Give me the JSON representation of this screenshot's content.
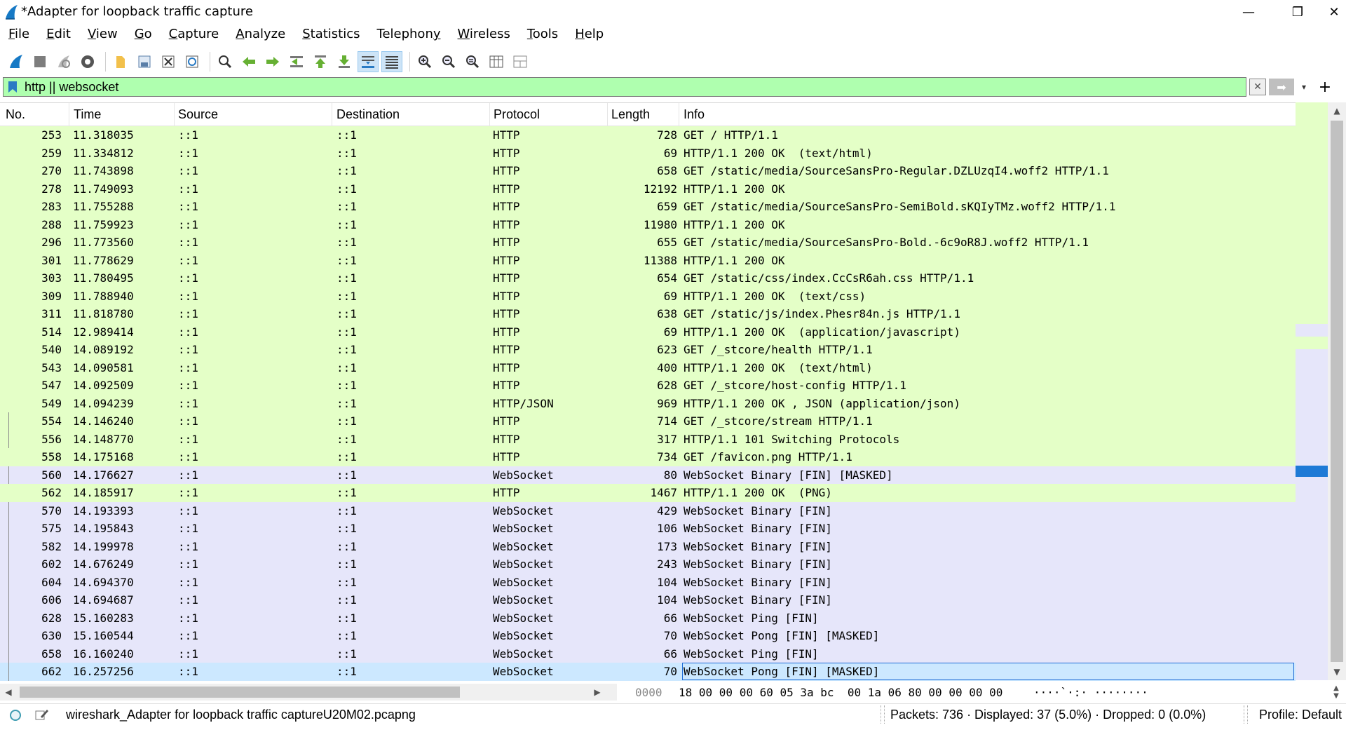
{
  "window": {
    "title": "*Adapter for loopback traffic capture",
    "minimize": "—",
    "restore": "❐",
    "close": "✕"
  },
  "menu": [
    {
      "label": "File",
      "key": "F",
      "rest": "ile"
    },
    {
      "label": "Edit",
      "key": "E",
      "rest": "dit"
    },
    {
      "label": "View",
      "key": "V",
      "rest": "iew"
    },
    {
      "label": "Go",
      "key": "G",
      "rest": "o"
    },
    {
      "label": "Capture",
      "key": "C",
      "rest": "apture"
    },
    {
      "label": "Analyze",
      "key": "A",
      "rest": "nalyze"
    },
    {
      "label": "Statistics",
      "key": "S",
      "rest": "tatistics"
    },
    {
      "label": "Telephony",
      "key": "y",
      "pre": "Telephon",
      "rest": ""
    },
    {
      "label": "Wireless",
      "key": "W",
      "rest": "ireless"
    },
    {
      "label": "Tools",
      "key": "T",
      "rest": "ools"
    },
    {
      "label": "Help",
      "key": "H",
      "rest": "elp"
    }
  ],
  "toolbar_icons": [
    "start-capture-icon",
    "stop-capture-icon",
    "restart-capture-icon",
    "capture-options-icon",
    "open-file-icon",
    "save-file-icon",
    "close-file-icon",
    "reload-file-icon",
    "find-packet-icon",
    "go-back-icon",
    "go-forward-icon",
    "go-to-packet-icon",
    "first-packet-icon",
    "last-packet-icon",
    "autoscroll-icon",
    "colorize-icon",
    "zoom-in-icon",
    "zoom-out-icon",
    "zoom-normal-icon",
    "resize-columns-icon",
    "layout-icon"
  ],
  "filter": {
    "text": "http || websocket",
    "clear": "✕",
    "apply": "➡",
    "dropdown": "▾",
    "add": "+"
  },
  "columns": {
    "no": "No.",
    "time": "Time",
    "source": "Source",
    "destination": "Destination",
    "protocol": "Protocol",
    "length": "Length",
    "info": "Info"
  },
  "packets": [
    {
      "no": "253",
      "time": "11.318035",
      "src": "::1",
      "dst": "::1",
      "proto": "HTTP",
      "len": "728",
      "info": "GET / HTTP/1.1",
      "kind": "http",
      "tree": false
    },
    {
      "no": "259",
      "time": "11.334812",
      "src": "::1",
      "dst": "::1",
      "proto": "HTTP",
      "len": "69",
      "info": "HTTP/1.1 200 OK  (text/html)",
      "kind": "http",
      "tree": false
    },
    {
      "no": "270",
      "time": "11.743898",
      "src": "::1",
      "dst": "::1",
      "proto": "HTTP",
      "len": "658",
      "info": "GET /static/media/SourceSansPro-Regular.DZLUzqI4.woff2 HTTP/1.1",
      "kind": "http",
      "tree": false
    },
    {
      "no": "278",
      "time": "11.749093",
      "src": "::1",
      "dst": "::1",
      "proto": "HTTP",
      "len": "12192",
      "info": "HTTP/1.1 200 OK",
      "kind": "http",
      "tree": false
    },
    {
      "no": "283",
      "time": "11.755288",
      "src": "::1",
      "dst": "::1",
      "proto": "HTTP",
      "len": "659",
      "info": "GET /static/media/SourceSansPro-SemiBold.sKQIyTMz.woff2 HTTP/1.1",
      "kind": "http",
      "tree": false
    },
    {
      "no": "288",
      "time": "11.759923",
      "src": "::1",
      "dst": "::1",
      "proto": "HTTP",
      "len": "11980",
      "info": "HTTP/1.1 200 OK",
      "kind": "http",
      "tree": false
    },
    {
      "no": "296",
      "time": "11.773560",
      "src": "::1",
      "dst": "::1",
      "proto": "HTTP",
      "len": "655",
      "info": "GET /static/media/SourceSansPro-Bold.-6c9oR8J.woff2 HTTP/1.1",
      "kind": "http",
      "tree": false
    },
    {
      "no": "301",
      "time": "11.778629",
      "src": "::1",
      "dst": "::1",
      "proto": "HTTP",
      "len": "11388",
      "info": "HTTP/1.1 200 OK",
      "kind": "http",
      "tree": false
    },
    {
      "no": "303",
      "time": "11.780495",
      "src": "::1",
      "dst": "::1",
      "proto": "HTTP",
      "len": "654",
      "info": "GET /static/css/index.CcCsR6ah.css HTTP/1.1",
      "kind": "http",
      "tree": false
    },
    {
      "no": "309",
      "time": "11.788940",
      "src": "::1",
      "dst": "::1",
      "proto": "HTTP",
      "len": "69",
      "info": "HTTP/1.1 200 OK  (text/css)",
      "kind": "http",
      "tree": false
    },
    {
      "no": "311",
      "time": "11.818780",
      "src": "::1",
      "dst": "::1",
      "proto": "HTTP",
      "len": "638",
      "info": "GET /static/js/index.Phesr84n.js HTTP/1.1",
      "kind": "http",
      "tree": false
    },
    {
      "no": "514",
      "time": "12.989414",
      "src": "::1",
      "dst": "::1",
      "proto": "HTTP",
      "len": "69",
      "info": "HTTP/1.1 200 OK  (application/javascript)",
      "kind": "http",
      "tree": false
    },
    {
      "no": "540",
      "time": "14.089192",
      "src": "::1",
      "dst": "::1",
      "proto": "HTTP",
      "len": "623",
      "info": "GET /_stcore/health HTTP/1.1",
      "kind": "http",
      "tree": false
    },
    {
      "no": "543",
      "time": "14.090581",
      "src": "::1",
      "dst": "::1",
      "proto": "HTTP",
      "len": "400",
      "info": "HTTP/1.1 200 OK  (text/html)",
      "kind": "http",
      "tree": false
    },
    {
      "no": "547",
      "time": "14.092509",
      "src": "::1",
      "dst": "::1",
      "proto": "HTTP",
      "len": "628",
      "info": "GET /_stcore/host-config HTTP/1.1",
      "kind": "http",
      "tree": false
    },
    {
      "no": "549",
      "time": "14.094239",
      "src": "::1",
      "dst": "::1",
      "proto": "HTTP/JSON",
      "len": "969",
      "info": "HTTP/1.1 200 OK , JSON (application/json)",
      "kind": "http",
      "tree": false
    },
    {
      "no": "554",
      "time": "14.146240",
      "src": "::1",
      "dst": "::1",
      "proto": "HTTP",
      "len": "714",
      "info": "GET /_stcore/stream HTTP/1.1",
      "kind": "http",
      "tree": true
    },
    {
      "no": "556",
      "time": "14.148770",
      "src": "::1",
      "dst": "::1",
      "proto": "HTTP",
      "len": "317",
      "info": "HTTP/1.1 101 Switching Protocols",
      "kind": "http",
      "tree": true
    },
    {
      "no": "558",
      "time": "14.175168",
      "src": "::1",
      "dst": "::1",
      "proto": "HTTP",
      "len": "734",
      "info": "GET /favicon.png HTTP/1.1",
      "kind": "http",
      "tree": false
    },
    {
      "no": "560",
      "time": "14.176627",
      "src": "::1",
      "dst": "::1",
      "proto": "WebSocket",
      "len": "80",
      "info": "WebSocket Binary [FIN] [MASKED]",
      "kind": "ws",
      "tree": true
    },
    {
      "no": "562",
      "time": "14.185917",
      "src": "::1",
      "dst": "::1",
      "proto": "HTTP",
      "len": "1467",
      "info": "HTTP/1.1 200 OK  (PNG)",
      "kind": "http",
      "tree": false
    },
    {
      "no": "570",
      "time": "14.193393",
      "src": "::1",
      "dst": "::1",
      "proto": "WebSocket",
      "len": "429",
      "info": "WebSocket Binary [FIN]",
      "kind": "ws",
      "tree": true
    },
    {
      "no": "575",
      "time": "14.195843",
      "src": "::1",
      "dst": "::1",
      "proto": "WebSocket",
      "len": "106",
      "info": "WebSocket Binary [FIN]",
      "kind": "ws",
      "tree": true
    },
    {
      "no": "582",
      "time": "14.199978",
      "src": "::1",
      "dst": "::1",
      "proto": "WebSocket",
      "len": "173",
      "info": "WebSocket Binary [FIN]",
      "kind": "ws",
      "tree": true
    },
    {
      "no": "602",
      "time": "14.676249",
      "src": "::1",
      "dst": "::1",
      "proto": "WebSocket",
      "len": "243",
      "info": "WebSocket Binary [FIN]",
      "kind": "ws",
      "tree": true
    },
    {
      "no": "604",
      "time": "14.694370",
      "src": "::1",
      "dst": "::1",
      "proto": "WebSocket",
      "len": "104",
      "info": "WebSocket Binary [FIN]",
      "kind": "ws",
      "tree": true
    },
    {
      "no": "606",
      "time": "14.694687",
      "src": "::1",
      "dst": "::1",
      "proto": "WebSocket",
      "len": "104",
      "info": "WebSocket Binary [FIN]",
      "kind": "ws",
      "tree": true
    },
    {
      "no": "628",
      "time": "15.160283",
      "src": "::1",
      "dst": "::1",
      "proto": "WebSocket",
      "len": "66",
      "info": "WebSocket Ping [FIN]",
      "kind": "ws",
      "tree": true
    },
    {
      "no": "630",
      "time": "15.160544",
      "src": "::1",
      "dst": "::1",
      "proto": "WebSocket",
      "len": "70",
      "info": "WebSocket Pong [FIN] [MASKED]",
      "kind": "ws",
      "tree": true
    },
    {
      "no": "658",
      "time": "16.160240",
      "src": "::1",
      "dst": "::1",
      "proto": "WebSocket",
      "len": "66",
      "info": "WebSocket Ping [FIN]",
      "kind": "ws",
      "tree": true
    },
    {
      "no": "662",
      "time": "16.257256",
      "src": "::1",
      "dst": "::1",
      "proto": "WebSocket",
      "len": "70",
      "info": "WebSocket Pong [FIN] [MASKED]",
      "kind": "sel",
      "tree": true
    }
  ],
  "bytes": {
    "offset": "0000",
    "hex": "18 00 00 00 60 05 3a bc  00 1a 06 80 00 00 00 00",
    "ascii": "····`·:· ········"
  },
  "status": {
    "file": "wireshark_Adapter for loopback traffic captureU20M02.pcapng",
    "packets": "Packets: 736 · Displayed: 37 (5.0%) · Dropped: 0 (0.0%)",
    "profile": "Profile: Default"
  },
  "colors": {
    "http_row": "#e4ffc7",
    "websocket_row": "#e6e6fa",
    "selected_row": "#cce8ff",
    "filter_valid": "#afffaf",
    "accent": "#1e7ad6"
  }
}
